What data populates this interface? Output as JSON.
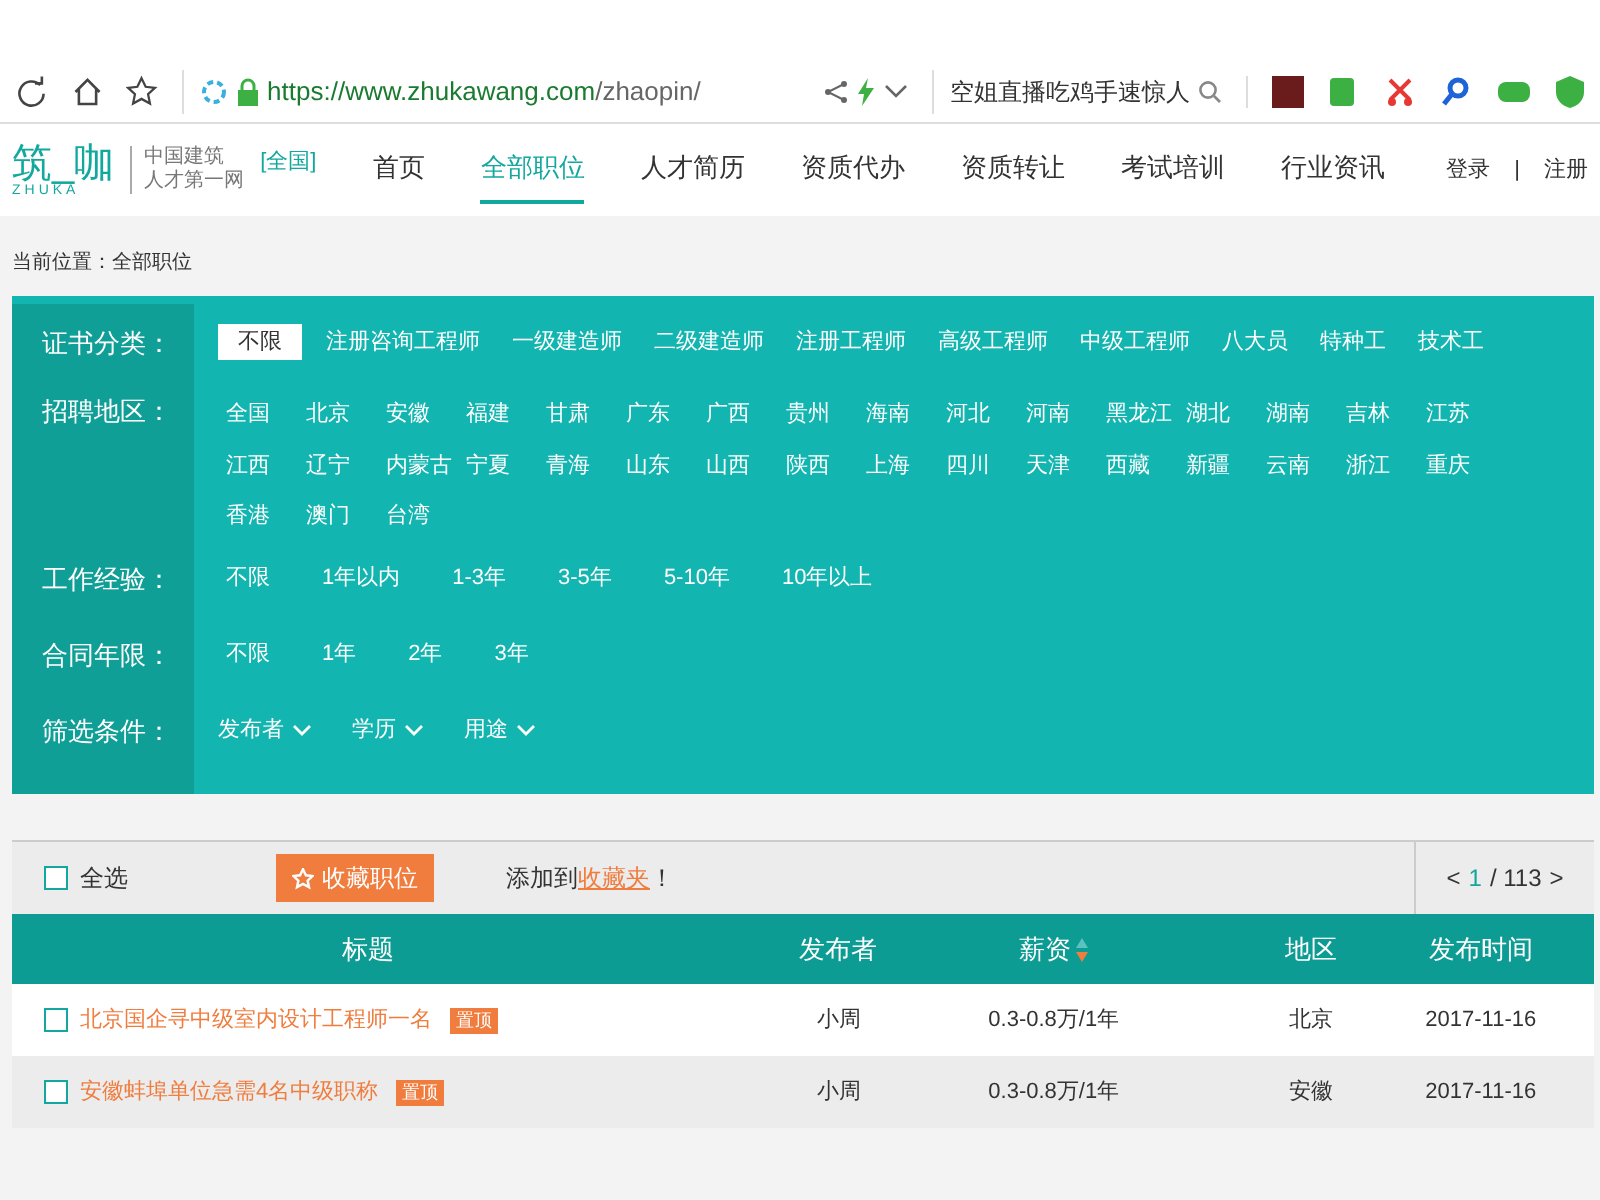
{
  "browser": {
    "url_host": "https://www.zhukawang.com",
    "url_path": "/zhaopin/",
    "search_text": "空姐直播吃鸡手速惊人"
  },
  "site": {
    "logo": "筑_咖",
    "logo_sub": "ZHUKA",
    "tagline_1": "中国建筑",
    "tagline_2": "人才第一网",
    "region": "[全国]",
    "nav": [
      {
        "label": "首页",
        "selected": false
      },
      {
        "label": "全部职位",
        "selected": true
      },
      {
        "label": "人才简历",
        "selected": false
      },
      {
        "label": "资质代办",
        "selected": false
      },
      {
        "label": "资质转让",
        "selected": false
      },
      {
        "label": "考试培训",
        "selected": false
      },
      {
        "label": "行业资讯",
        "selected": false
      }
    ],
    "login": "登录",
    "divider": "|",
    "register": "注册"
  },
  "breadcrumb": "当前位置：全部职位",
  "filters": [
    {
      "label": "证书分类：",
      "kind": "options",
      "options": [
        {
          "label": "不限",
          "selected": true
        },
        {
          "label": "注册咨询工程师",
          "selected": false
        },
        {
          "label": "一级建造师",
          "selected": false
        },
        {
          "label": "二级建造师",
          "selected": false
        },
        {
          "label": "注册工程师",
          "selected": false
        },
        {
          "label": "高级工程师",
          "selected": false
        },
        {
          "label": "中级工程师",
          "selected": false
        },
        {
          "label": "八大员",
          "selected": false
        },
        {
          "label": "特种工",
          "selected": false
        },
        {
          "label": "技术工",
          "selected": false
        }
      ]
    },
    {
      "label": "招聘地区：",
      "kind": "grid",
      "options": [
        {
          "label": "全国",
          "selected": false
        },
        {
          "label": "北京",
          "selected": false
        },
        {
          "label": "安徽",
          "selected": false
        },
        {
          "label": "福建",
          "selected": false
        },
        {
          "label": "甘肃",
          "selected": false
        },
        {
          "label": "广东",
          "selected": false
        },
        {
          "label": "广西",
          "selected": false
        },
        {
          "label": "贵州",
          "selected": false
        },
        {
          "label": "海南",
          "selected": false
        },
        {
          "label": "河北",
          "selected": false
        },
        {
          "label": "河南",
          "selected": false
        },
        {
          "label": "黑龙江",
          "selected": false
        },
        {
          "label": "湖北",
          "selected": false
        },
        {
          "label": "湖南",
          "selected": false
        },
        {
          "label": "吉林",
          "selected": false
        },
        {
          "label": "江苏",
          "selected": false
        },
        {
          "label": "江西",
          "selected": false
        },
        {
          "label": "辽宁",
          "selected": false
        },
        {
          "label": "内蒙古",
          "selected": false
        },
        {
          "label": "宁夏",
          "selected": false
        },
        {
          "label": "青海",
          "selected": false
        },
        {
          "label": "山东",
          "selected": false
        },
        {
          "label": "山西",
          "selected": false
        },
        {
          "label": "陕西",
          "selected": false
        },
        {
          "label": "上海",
          "selected": false
        },
        {
          "label": "四川",
          "selected": false
        },
        {
          "label": "天津",
          "selected": false
        },
        {
          "label": "西藏",
          "selected": false
        },
        {
          "label": "新疆",
          "selected": false
        },
        {
          "label": "云南",
          "selected": false
        },
        {
          "label": "浙江",
          "selected": false
        },
        {
          "label": "重庆",
          "selected": false
        },
        {
          "label": "香港",
          "selected": false
        },
        {
          "label": "澳门",
          "selected": false
        },
        {
          "label": "台湾",
          "selected": false
        }
      ]
    },
    {
      "label": "工作经验：",
      "kind": "options",
      "options": [
        {
          "label": "不限",
          "selected": false
        },
        {
          "label": "1年以内",
          "selected": false
        },
        {
          "label": "1-3年",
          "selected": false
        },
        {
          "label": "3-5年",
          "selected": false
        },
        {
          "label": "5-10年",
          "selected": false
        },
        {
          "label": "10年以上",
          "selected": false
        }
      ]
    },
    {
      "label": "合同年限：",
      "kind": "options",
      "options": [
        {
          "label": "不限",
          "selected": false
        },
        {
          "label": "1年",
          "selected": false
        },
        {
          "label": "2年",
          "selected": false
        },
        {
          "label": "3年",
          "selected": false
        }
      ]
    },
    {
      "label": "筛选条件：",
      "kind": "dropdowns",
      "options": [
        {
          "label": "发布者",
          "selected": false
        },
        {
          "label": "学历",
          "selected": false
        },
        {
          "label": "用途",
          "selected": false
        }
      ]
    }
  ],
  "toolbar": {
    "select_all": "全选",
    "select_all_checked": false,
    "favorite_button": "收藏职位",
    "hint_before": "添加到",
    "hint_link": "收藏夹",
    "hint_after": "！",
    "page_prev": "<",
    "page_current": "1",
    "page_sep": "/ 113",
    "page_next": ">"
  },
  "table": {
    "columns": [
      "标题",
      "发布者",
      "薪资",
      "地区",
      "发布时间"
    ],
    "rows": [
      {
        "title": "北京国企寻中级室内设计工程师一名",
        "tag": "置顶",
        "checked": false,
        "publisher": "小周",
        "salary": "0.3-0.8万/1年",
        "region": "北京",
        "date": "2017-11-16"
      },
      {
        "title": "安徽蚌埠单位急需4名中级职称",
        "tag": "置顶",
        "checked": false,
        "publisher": "小周",
        "salary": "0.3-0.8万/1年",
        "region": "安徽",
        "date": "2017-11-16"
      }
    ]
  }
}
